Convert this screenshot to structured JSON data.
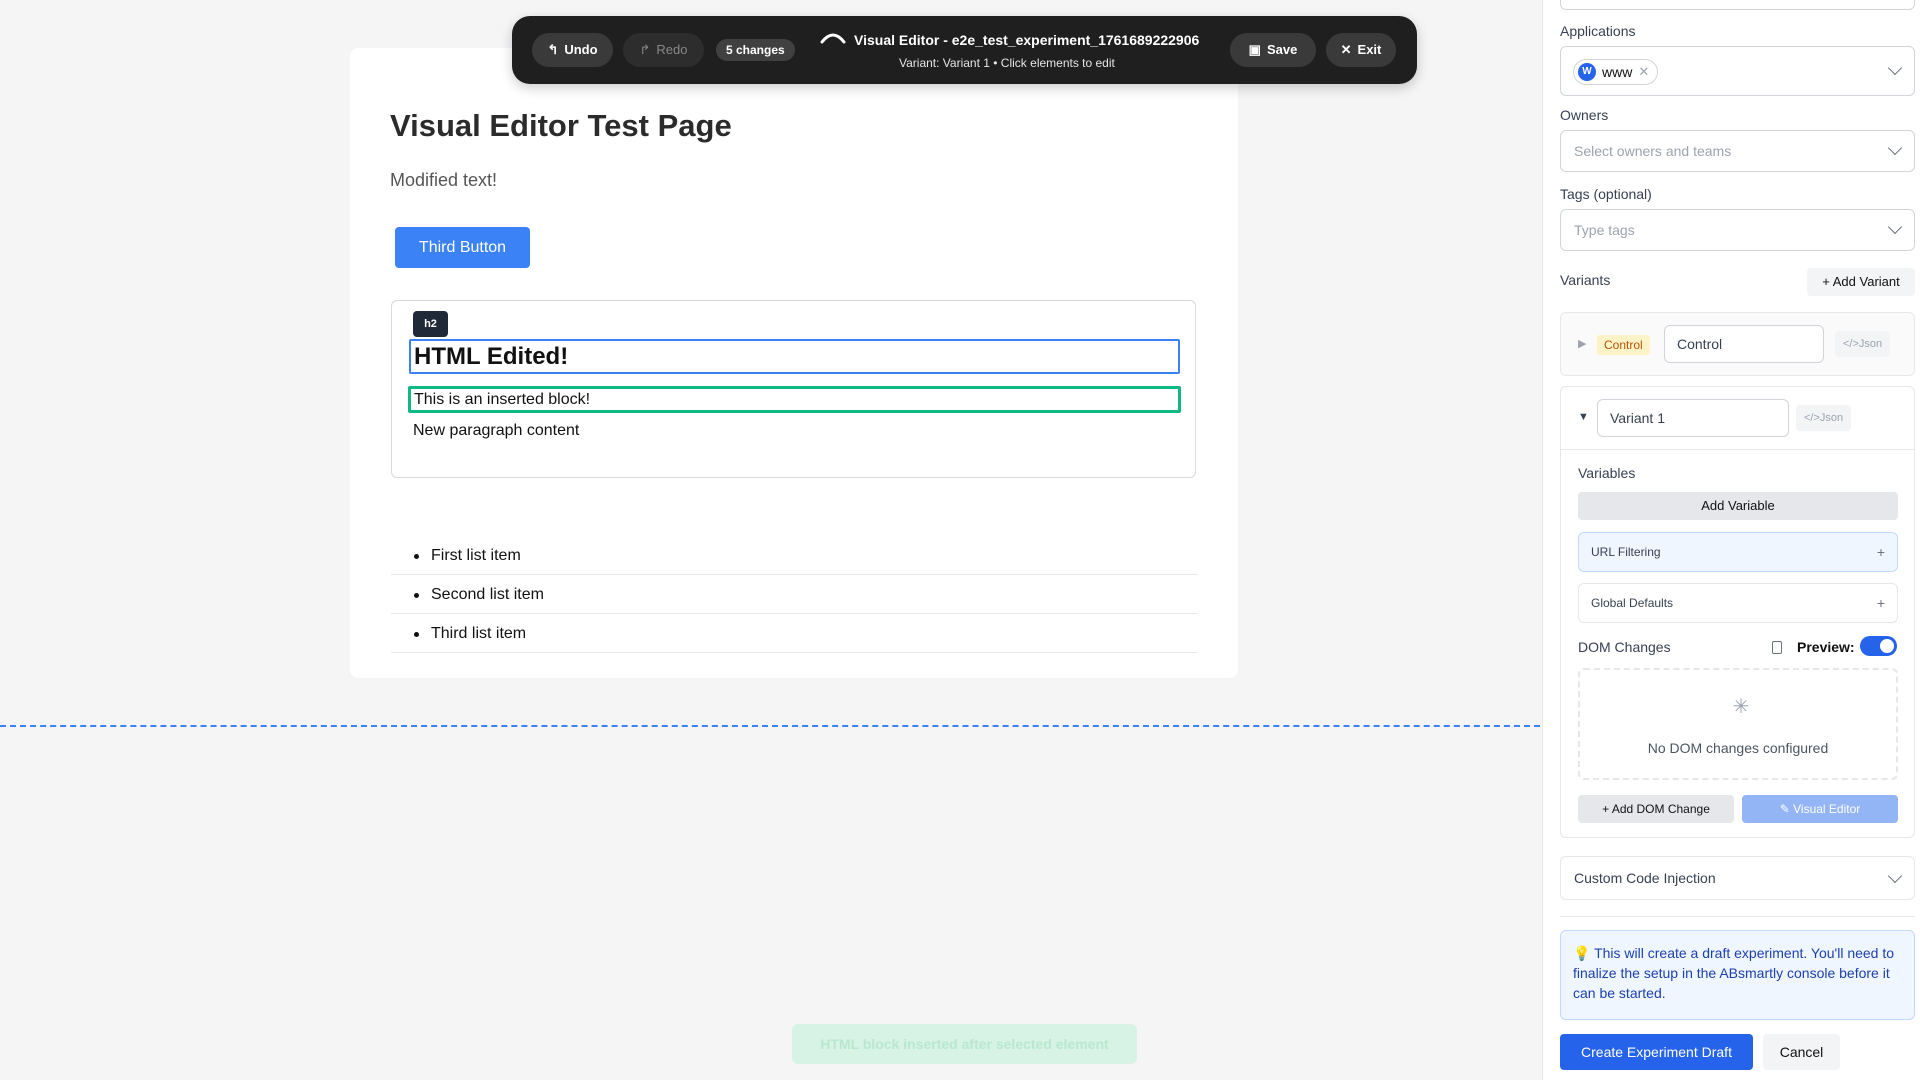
{
  "page": {
    "title": "Visual Editor Test Page",
    "subtitle": "Modified text!",
    "third_button": "Third Button",
    "tag_badge": "h2",
    "h2_text": "HTML Edited!",
    "inserted_block": "This is an inserted block!",
    "new_paragraph": "New paragraph content",
    "list_items": [
      "First list item",
      "Second list item",
      "Third list item"
    ]
  },
  "toolbar": {
    "undo": "Undo",
    "redo": "Redo",
    "changes": "5 changes",
    "title": "Visual Editor - e2e_test_experiment_1761689222906",
    "subtitle": "Variant: Variant 1 • Click elements to edit",
    "save": "Save",
    "exit": "Exit"
  },
  "toast": "HTML block inserted after selected element",
  "sidebar": {
    "applications_label": "Applications",
    "applications_chip": "www",
    "applications_chip_avatar": "W",
    "owners_label": "Owners",
    "owners_placeholder": "Select owners and teams",
    "tags_label": "Tags (optional)",
    "tags_placeholder": "Type tags",
    "variants_label": "Variants",
    "add_variant": "Add Variant",
    "control_badge": "Control",
    "control_name": "Control",
    "json_label": "</>Json",
    "variant1_name": "Variant 1",
    "variables_label": "Variables",
    "add_variable": "Add Variable",
    "url_filtering": "URL Filtering",
    "global_defaults": "Global Defaults",
    "dom_changes": "DOM Changes",
    "preview": "Preview:",
    "preview_on": true,
    "no_dom_changes": "No DOM changes configured",
    "add_dom_change": "Add DOM Change",
    "visual_editor": "Visual Editor",
    "custom_code": "Custom Code Injection",
    "info_text": "This will create a draft experiment. You'll need to finalize the setup in the ABsmartly console before it can be started.",
    "create_draft": "Create Experiment Draft",
    "cancel": "Cancel"
  },
  "colors": {
    "accent": "#2563eb",
    "selected_outline": "#3b82f6",
    "inserted_outline": "#10b981",
    "toolbar_bg": "#1f1f1f"
  }
}
